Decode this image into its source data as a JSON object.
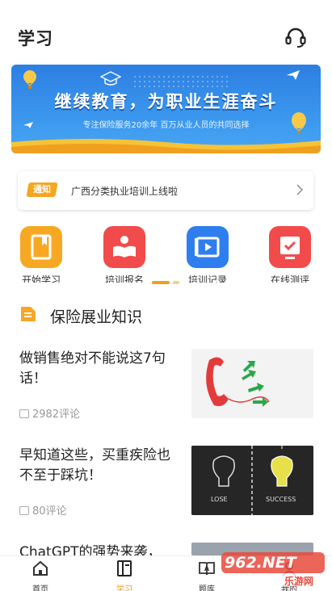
{
  "header": {
    "title": "学习"
  },
  "banner": {
    "headline": "继续教育，为职业生涯奋斗",
    "subtitle": "专注保险服务20余年  百万从业人员的共同选择"
  },
  "notice": {
    "tag": "通知",
    "text": "广西分类执业培训上线啦"
  },
  "quick_actions": [
    {
      "label": "开始学习",
      "color": "#f7a823"
    },
    {
      "label": "培训报名",
      "color": "#f24b4b"
    },
    {
      "label": "培训记录",
      "color": "#2f7ef0"
    },
    {
      "label": "在线测评",
      "color": "#f24b4b"
    }
  ],
  "section": {
    "title": "保险展业知识"
  },
  "articles": [
    {
      "title": "做销售绝对不能说这7句话！",
      "comments": "2982评论"
    },
    {
      "title": "早知道这些，买重疾险也不至于踩坑！",
      "comments": "80评论",
      "thumb_left": "LOSE",
      "thumb_right": "SUCCESS"
    },
    {
      "title": "ChatGPT的强势来袭，",
      "comments": ""
    }
  ],
  "bottom_nav": [
    {
      "label": "首页",
      "active": false
    },
    {
      "label": "学习",
      "active": true
    },
    {
      "label": "题库",
      "active": false
    },
    {
      "label": "我的",
      "active": false
    }
  ],
  "watermark": {
    "text": "962.NET",
    "sub": "乐游网"
  },
  "colors": {
    "accent": "#f0a020",
    "banner_blue": "#2d7fe2"
  }
}
